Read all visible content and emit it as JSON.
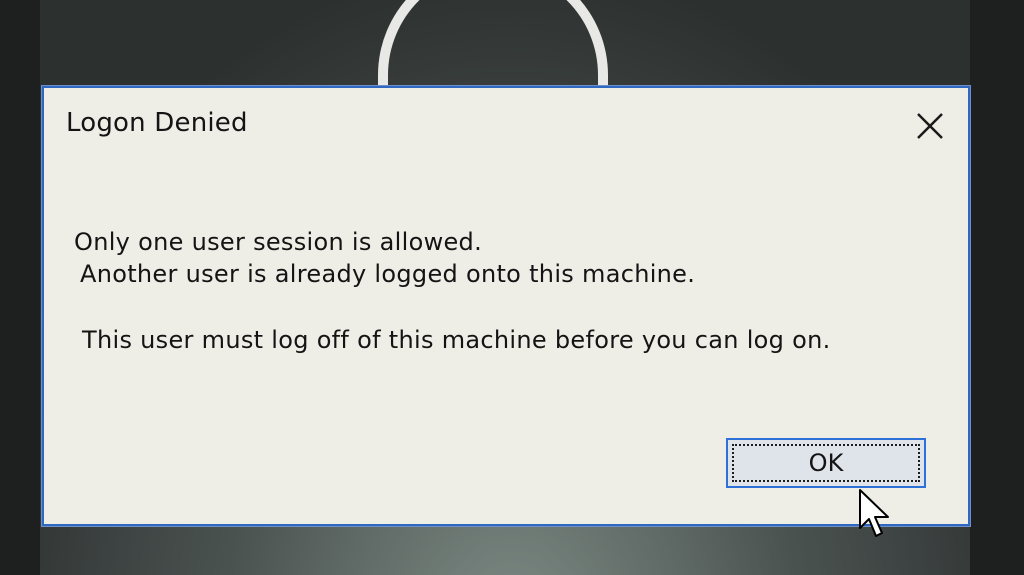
{
  "dialog": {
    "title": "Logon Denied",
    "close_icon": "close-icon",
    "message_line1": "Only one user session is allowed.",
    "message_line2": "Another user is already logged onto this machine.",
    "message_line3": "This user must log off of this machine before you can log on.",
    "ok_label": "OK"
  },
  "colors": {
    "dialog_background": "#eeede6",
    "dialog_border": "#2f68c0",
    "button_border": "#2c70d8"
  }
}
